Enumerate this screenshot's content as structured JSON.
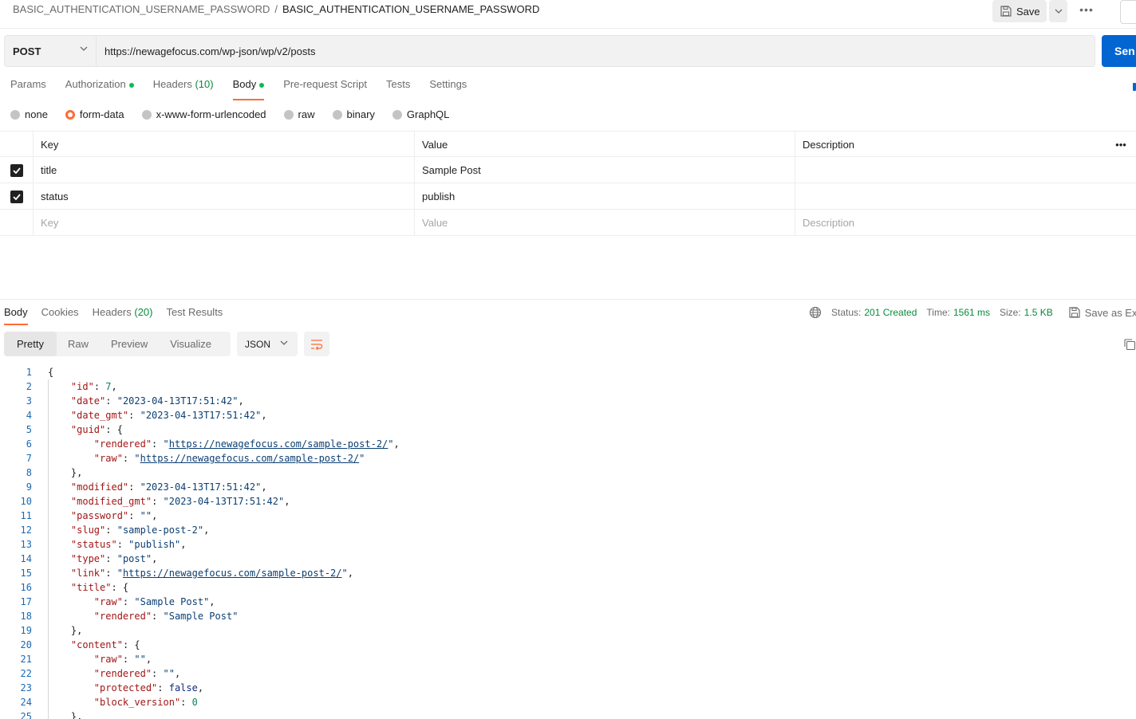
{
  "breadcrumb": {
    "parent": "BASIC_AUTHENTICATION_USERNAME_PASSWORD",
    "separator": "/",
    "current": "BASIC_AUTHENTICATION_USERNAME_PASSWORD"
  },
  "toolbar": {
    "save_label": "Save"
  },
  "request": {
    "method": "POST",
    "url": "https://newagefocus.com/wp-json/wp/v2/posts",
    "send_label": "Sen"
  },
  "request_tabs": [
    {
      "label": "Params"
    },
    {
      "label": "Authorization"
    },
    {
      "label": "Headers",
      "count": "(10)"
    },
    {
      "label": "Body"
    },
    {
      "label": "Pre-request Script"
    },
    {
      "label": "Tests"
    },
    {
      "label": "Settings"
    }
  ],
  "body_types": [
    "none",
    "form-data",
    "x-www-form-urlencoded",
    "raw",
    "binary",
    "GraphQL"
  ],
  "params_table": {
    "headers": {
      "key": "Key",
      "value": "Value",
      "description": "Description"
    },
    "rows": [
      {
        "key": "title",
        "value": "Sample Post",
        "description": ""
      },
      {
        "key": "status",
        "value": "publish",
        "description": ""
      }
    ],
    "placeholders": {
      "key": "Key",
      "value": "Value",
      "description": "Description"
    }
  },
  "response_tabs": [
    {
      "label": "Body"
    },
    {
      "label": "Cookies"
    },
    {
      "label": "Headers",
      "count": "(20)"
    },
    {
      "label": "Test Results"
    }
  ],
  "response_meta": {
    "status_label": "Status:",
    "status_value": "201 Created",
    "time_label": "Time:",
    "time_value": "1561 ms",
    "size_label": "Size:",
    "size_value": "1.5 KB",
    "save_example": "Save as Exam"
  },
  "format_tabs": [
    "Pretty",
    "Raw",
    "Preview",
    "Visualize"
  ],
  "language": "JSON",
  "code_lines": [
    [
      [
        "p",
        "{"
      ]
    ],
    [
      [
        "p",
        "    "
      ],
      [
        "k",
        "\"id\""
      ],
      [
        "p",
        ": "
      ],
      [
        "n",
        "7"
      ],
      [
        "p",
        ","
      ]
    ],
    [
      [
        "p",
        "    "
      ],
      [
        "k",
        "\"date\""
      ],
      [
        "p",
        ": "
      ],
      [
        "s",
        "\"2023-04-13T17:51:42\""
      ],
      [
        "p",
        ","
      ]
    ],
    [
      [
        "p",
        "    "
      ],
      [
        "k",
        "\"date_gmt\""
      ],
      [
        "p",
        ": "
      ],
      [
        "s",
        "\"2023-04-13T17:51:42\""
      ],
      [
        "p",
        ","
      ]
    ],
    [
      [
        "p",
        "    "
      ],
      [
        "k",
        "\"guid\""
      ],
      [
        "p",
        ": {"
      ]
    ],
    [
      [
        "p",
        "        "
      ],
      [
        "k",
        "\"rendered\""
      ],
      [
        "p",
        ": "
      ],
      [
        "s",
        "\""
      ],
      [
        "u",
        "https://newagefocus.com/sample-post-2/"
      ],
      [
        "s",
        "\""
      ],
      [
        "p",
        ","
      ]
    ],
    [
      [
        "p",
        "        "
      ],
      [
        "k",
        "\"raw\""
      ],
      [
        "p",
        ": "
      ],
      [
        "s",
        "\""
      ],
      [
        "u",
        "https://newagefocus.com/sample-post-2/"
      ],
      [
        "s",
        "\""
      ]
    ],
    [
      [
        "p",
        "    },"
      ]
    ],
    [
      [
        "p",
        "    "
      ],
      [
        "k",
        "\"modified\""
      ],
      [
        "p",
        ": "
      ],
      [
        "s",
        "\"2023-04-13T17:51:42\""
      ],
      [
        "p",
        ","
      ]
    ],
    [
      [
        "p",
        "    "
      ],
      [
        "k",
        "\"modified_gmt\""
      ],
      [
        "p",
        ": "
      ],
      [
        "s",
        "\"2023-04-13T17:51:42\""
      ],
      [
        "p",
        ","
      ]
    ],
    [
      [
        "p",
        "    "
      ],
      [
        "k",
        "\"password\""
      ],
      [
        "p",
        ": "
      ],
      [
        "s",
        "\"\""
      ],
      [
        "p",
        ","
      ]
    ],
    [
      [
        "p",
        "    "
      ],
      [
        "k",
        "\"slug\""
      ],
      [
        "p",
        ": "
      ],
      [
        "s",
        "\"sample-post-2\""
      ],
      [
        "p",
        ","
      ]
    ],
    [
      [
        "p",
        "    "
      ],
      [
        "k",
        "\"status\""
      ],
      [
        "p",
        ": "
      ],
      [
        "s",
        "\"publish\""
      ],
      [
        "p",
        ","
      ]
    ],
    [
      [
        "p",
        "    "
      ],
      [
        "k",
        "\"type\""
      ],
      [
        "p",
        ": "
      ],
      [
        "s",
        "\"post\""
      ],
      [
        "p",
        ","
      ]
    ],
    [
      [
        "p",
        "    "
      ],
      [
        "k",
        "\"link\""
      ],
      [
        "p",
        ": "
      ],
      [
        "s",
        "\""
      ],
      [
        "u",
        "https://newagefocus.com/sample-post-2/"
      ],
      [
        "s",
        "\""
      ],
      [
        "p",
        ","
      ]
    ],
    [
      [
        "p",
        "    "
      ],
      [
        "k",
        "\"title\""
      ],
      [
        "p",
        ": {"
      ]
    ],
    [
      [
        "p",
        "        "
      ],
      [
        "k",
        "\"raw\""
      ],
      [
        "p",
        ": "
      ],
      [
        "s",
        "\"Sample Post\""
      ],
      [
        "p",
        ","
      ]
    ],
    [
      [
        "p",
        "        "
      ],
      [
        "k",
        "\"rendered\""
      ],
      [
        "p",
        ": "
      ],
      [
        "s",
        "\"Sample Post\""
      ]
    ],
    [
      [
        "p",
        "    },"
      ]
    ],
    [
      [
        "p",
        "    "
      ],
      [
        "k",
        "\"content\""
      ],
      [
        "p",
        ": {"
      ]
    ],
    [
      [
        "p",
        "        "
      ],
      [
        "k",
        "\"raw\""
      ],
      [
        "p",
        ": "
      ],
      [
        "s",
        "\"\""
      ],
      [
        "p",
        ","
      ]
    ],
    [
      [
        "p",
        "        "
      ],
      [
        "k",
        "\"rendered\""
      ],
      [
        "p",
        ": "
      ],
      [
        "s",
        "\"\""
      ],
      [
        "p",
        ","
      ]
    ],
    [
      [
        "p",
        "        "
      ],
      [
        "k",
        "\"protected\""
      ],
      [
        "p",
        ": "
      ],
      [
        "b",
        "false"
      ],
      [
        "p",
        ","
      ]
    ],
    [
      [
        "p",
        "        "
      ],
      [
        "k",
        "\"block_version\""
      ],
      [
        "p",
        ": "
      ],
      [
        "n",
        "0"
      ]
    ],
    [
      [
        "p",
        "    },"
      ]
    ]
  ]
}
